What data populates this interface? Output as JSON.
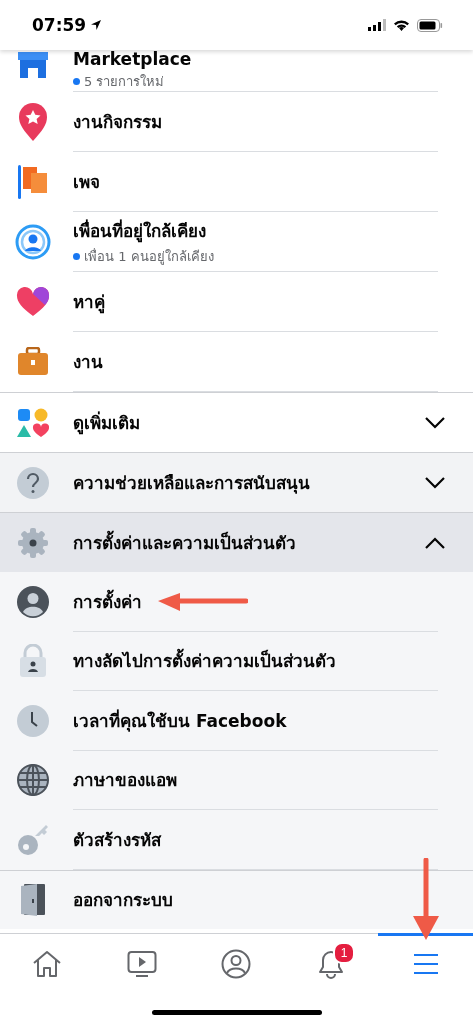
{
  "status_bar": {
    "time": "07:59"
  },
  "menu": [
    {
      "kind": "shortcut",
      "label": "Marketplace",
      "subtitle": "5 รายการใหม่"
    },
    {
      "kind": "shortcut",
      "label": "งานกิจกรรม"
    },
    {
      "kind": "shortcut",
      "label": "เพจ"
    },
    {
      "kind": "shortcut",
      "label": "เพื่อนที่อยู่ใกล้เคียง",
      "subtitle": "เพื่อน 1 คนอยู่ใกล้เคียง"
    },
    {
      "kind": "shortcut",
      "label": "หาคู่"
    },
    {
      "kind": "shortcut",
      "label": "งาน"
    },
    {
      "kind": "section",
      "label": "ดูเพิ่มเติม",
      "expanded": false
    },
    {
      "kind": "section",
      "label": "ความช่วยเหลือและการสนับสนุน",
      "expanded": false
    },
    {
      "kind": "section",
      "label": "การตั้งค่าและความเป็นส่วนตัว",
      "expanded": true
    },
    {
      "kind": "setting",
      "label": "การตั้งค่า"
    },
    {
      "kind": "setting",
      "label": "ทางลัดไปการตั้งค่าความเป็นส่วนตัว"
    },
    {
      "kind": "setting",
      "label": "เวลาที่คุณใช้บน Facebook"
    },
    {
      "kind": "setting",
      "label": "ภาษาของแอพ"
    },
    {
      "kind": "setting",
      "label": "ตัวสร้างรหัส"
    },
    {
      "kind": "logout",
      "label": "ออกจากระบบ"
    }
  ],
  "tab_bar": [
    {
      "selected": false
    },
    {
      "selected": false
    },
    {
      "selected": false
    },
    {
      "selected": false,
      "badge": "1"
    },
    {
      "selected": true
    }
  ]
}
